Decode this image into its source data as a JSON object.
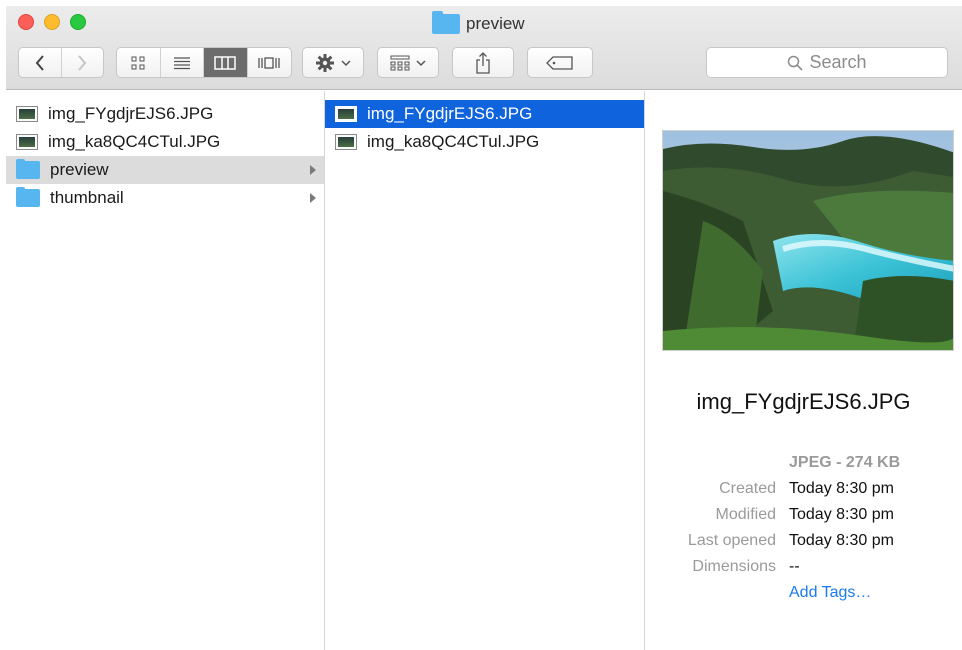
{
  "window": {
    "title": "preview"
  },
  "toolbar": {
    "back_icon": "chevron-left-icon",
    "forward_icon": "chevron-right-icon",
    "view_icons": [
      "icon-view-icon",
      "list-view-icon",
      "column-view-icon",
      "coverflow-view-icon"
    ],
    "active_view": "column",
    "action_icon": "gear-icon",
    "arrange_icon": "arrange-grid-icon",
    "share_icon": "share-icon",
    "tags_icon": "tag-icon",
    "search_placeholder": "Search"
  },
  "column1": {
    "items": [
      {
        "label": "img_FYgdjrEJS6.JPG",
        "kind": "image"
      },
      {
        "label": "img_ka8QC4CTul.JPG",
        "kind": "image"
      },
      {
        "label": "preview",
        "kind": "folder"
      },
      {
        "label": "thumbnail",
        "kind": "folder"
      }
    ]
  },
  "column2": {
    "items": [
      {
        "label": "img_FYgdjrEJS6.JPG",
        "kind": "image"
      },
      {
        "label": "img_ka8QC4CTul.JPG",
        "kind": "image"
      }
    ]
  },
  "preview": {
    "name": "img_FYgdjrEJS6.JPG",
    "kind": "JPEG - 274 KB",
    "created_label": "Created",
    "created": "Today 8:30 pm",
    "modified_label": "Modified",
    "modified": "Today 8:30 pm",
    "last_opened_label": "Last opened",
    "last_opened": "Today 8:30 pm",
    "dimensions_label": "Dimensions",
    "dimensions": "--",
    "add_tags": "Add Tags…"
  },
  "colors": {
    "selection": "#0f63dd",
    "folder": "#57b6f0",
    "link": "#1a7af0"
  }
}
